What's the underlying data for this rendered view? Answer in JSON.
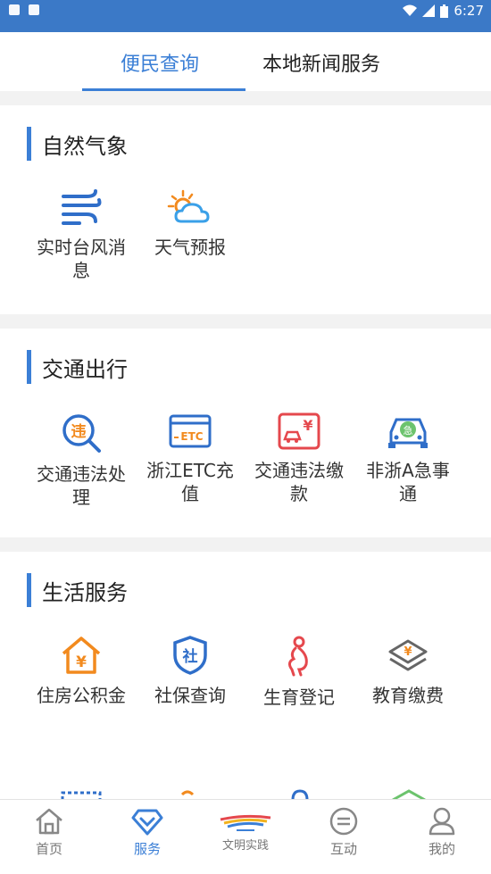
{
  "status_bar": {
    "time": "6:27"
  },
  "tabs": [
    {
      "label": "便民查询",
      "active": true
    },
    {
      "label": "本地新闻服务",
      "active": false
    }
  ],
  "sections": [
    {
      "title": "自然气象",
      "items": [
        {
          "label": "实时台风消息",
          "icon": "wind-icon"
        },
        {
          "label": "天气预报",
          "icon": "weather-icon"
        }
      ]
    },
    {
      "title": "交通出行",
      "items": [
        {
          "label": "交通违法处理",
          "icon": "violation-search-icon"
        },
        {
          "label": "浙江ETC充值",
          "icon": "etc-card-icon"
        },
        {
          "label": "交通违法缴款",
          "icon": "car-payment-icon"
        },
        {
          "label": "非浙A急事通",
          "icon": "car-urgent-icon"
        }
      ]
    },
    {
      "title": "生活服务",
      "items": [
        {
          "label": "住房公积金",
          "icon": "housing-fund-icon"
        },
        {
          "label": "社保查询",
          "icon": "social-security-icon"
        },
        {
          "label": "生育登记",
          "icon": "pregnancy-icon"
        },
        {
          "label": "教育缴费",
          "icon": "education-payment-icon"
        }
      ]
    }
  ],
  "bottom_nav": [
    {
      "label": "首页",
      "icon": "home-icon",
      "active": false
    },
    {
      "label": "服务",
      "icon": "service-icon",
      "active": true
    },
    {
      "label": "文明实践",
      "icon": "civilization-logo-icon",
      "active": false
    },
    {
      "label": "互动",
      "icon": "chat-icon",
      "active": false
    },
    {
      "label": "我的",
      "icon": "profile-icon",
      "active": false
    }
  ],
  "colors": {
    "accent": "#3b7fd6",
    "orange": "#f28a1e",
    "red": "#e5484d",
    "blue": "#2f6ec9"
  }
}
